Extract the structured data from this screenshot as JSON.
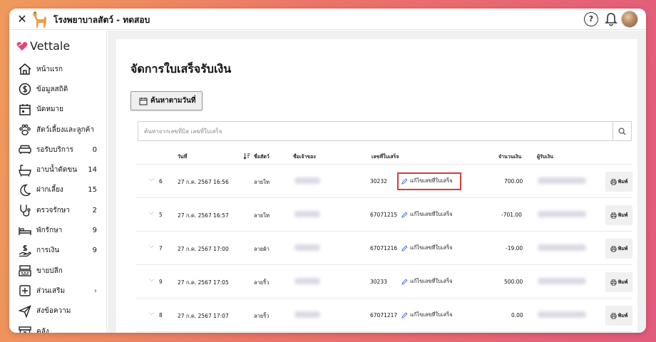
{
  "titlebar": {
    "title": "โรงพยาบาลสัตว์ - ทดสอบ",
    "help_label": "?"
  },
  "sidebar": {
    "logo_text": "Vettale",
    "items": [
      {
        "label": "หน้าแรก",
        "count": "",
        "icon": "home-icon"
      },
      {
        "label": "ข้อมูลสถิติ",
        "count": "",
        "icon": "stats-icon"
      },
      {
        "label": "นัดหมาย",
        "count": "",
        "icon": "calendar-icon"
      },
      {
        "label": "สัตว์เลี้ยงและลูกค้า",
        "count": "",
        "icon": "paw-icon"
      },
      {
        "label": "รอรับบริการ",
        "count": "0",
        "icon": "sofa-icon"
      },
      {
        "label": "อาบน้ำตัดขน",
        "count": "14",
        "icon": "bathtub-icon"
      },
      {
        "label": "ฝากเลี้ยง",
        "count": "15",
        "icon": "moon-icon"
      },
      {
        "label": "ตรวจรักษา",
        "count": "2",
        "icon": "stethoscope-icon"
      },
      {
        "label": "พักรักษา",
        "count": "9",
        "icon": "bed-icon"
      },
      {
        "label": "การเงิน",
        "count": "9",
        "icon": "money-icon"
      },
      {
        "label": "ขายปลีก",
        "count": "",
        "icon": "cash-register-icon"
      },
      {
        "label": "ส่วนเสริม",
        "count": "",
        "icon": "plus-box-icon",
        "chevron": "›"
      },
      {
        "label": "ส่งข้อความ",
        "count": "",
        "icon": "send-icon"
      },
      {
        "label": "คลัง",
        "count": "",
        "icon": "archive-icon"
      }
    ]
  },
  "main": {
    "title": "จัดการใบเสร็จรับเงิน",
    "date_search_label": "ค้นหาตามวันที่",
    "search": {
      "placeholder": "ค้นหาจากเลขที่บิล เลขที่ใบเสร็จ",
      "value": ""
    },
    "columns": {
      "date": "วันที่",
      "pet_name": "ชื่อสัตว์",
      "owner": "ชื่อเจ้าของ",
      "receipt_no": "เลขที่ใบเสร็จ",
      "amount": "จำนวนเงิน",
      "receiver": "ผู้รับเงิน"
    },
    "edit_label": "แก้ไขเลขที่ใบเสร็จ",
    "print_label": "พิมพ์",
    "rows": [
      {
        "id": "6",
        "date": "27 ก.ค. 2567 16:56",
        "pet": "ลายไท",
        "receipt": "30232",
        "amount": "700.00",
        "highlight": true
      },
      {
        "id": "5",
        "date": "27 ก.ค. 2567 16:57",
        "pet": "ลายไท",
        "receipt": "67071215",
        "amount": "-701.00",
        "highlight": false
      },
      {
        "id": "7",
        "date": "27 ก.ค. 2567 17:00",
        "pet": "ลายผ้า",
        "receipt": "67071216",
        "amount": "-19.00",
        "highlight": false
      },
      {
        "id": "9",
        "date": "27 ก.ค. 2567 17:05",
        "pet": "ลายริ้ว",
        "receipt": "30233",
        "amount": "500.00",
        "highlight": false
      },
      {
        "id": "8",
        "date": "27 ก.ค. 2567 17:07",
        "pet": "ลายริ้ว",
        "receipt": "67071217",
        "amount": "0.00",
        "highlight": false
      }
    ]
  },
  "colors": {
    "highlight_border": "#d93a3a",
    "logo_heart": "#e2457a",
    "edit_icon": "#3b6fd6"
  }
}
